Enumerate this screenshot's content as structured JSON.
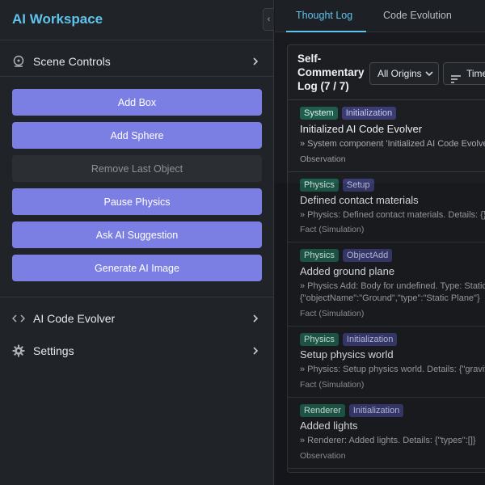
{
  "app": {
    "title": "AI Workspace",
    "collapse_glyph": "‹"
  },
  "sidebar": {
    "scene_controls": {
      "label": "Scene Controls",
      "icon": "scene-controls-icon"
    },
    "buttons": [
      {
        "label": "Add Box",
        "enabled": true
      },
      {
        "label": "Add Sphere",
        "enabled": true
      },
      {
        "label": "Remove Last Object",
        "enabled": false
      },
      {
        "label": "Pause Physics",
        "enabled": true
      },
      {
        "label": "Ask AI Suggestion",
        "enabled": true
      },
      {
        "label": "Generate AI Image",
        "enabled": true
      }
    ],
    "code_evolver": {
      "label": "AI Code Evolver",
      "icon": "code-icon"
    },
    "settings": {
      "label": "Settings",
      "icon": "gear-icon"
    }
  },
  "tabs": [
    {
      "label": "Thought Log",
      "active": true
    },
    {
      "label": "Code Evolution",
      "active": false
    }
  ],
  "log": {
    "title": "Self-Commentary Log (7 / 7)",
    "origin_filter": "All Origins",
    "sort_label": "Time"
  },
  "entries": [
    {
      "tags": [
        "System",
        "Initialization"
      ],
      "title": "Initialized AI Code Evolver",
      "detail": [
        "» System component 'Initialized AI Code Evolver'"
      ],
      "type": "Observation"
    },
    {
      "tags": [
        "Physics",
        "Setup"
      ],
      "title": "Defined contact materials",
      "detail": [
        "» Physics: Defined contact materials. Details: {}"
      ],
      "type": "Fact (Simulation)"
    },
    {
      "tags": [
        "Physics",
        "ObjectAdd"
      ],
      "title": "Added ground plane",
      "detail": [
        "» Physics Add: Body for undefined. Type: Static",
        "{\"objectName\":\"Ground\",\"type\":\"Static Plane\"}"
      ],
      "type": "Fact (Simulation)"
    },
    {
      "tags": [
        "Physics",
        "Initialization"
      ],
      "title": "Setup physics world",
      "detail": [
        "» Physics: Setup physics world. Details: {\"gravity\"}"
      ],
      "type": "Fact (Simulation)"
    },
    {
      "tags": [
        "Renderer",
        "Initialization"
      ],
      "title": "Added lights",
      "detail": [
        "» Renderer: Added lights. Details: {\"types\":[]}"
      ],
      "type": "Observation"
    }
  ],
  "colors": {
    "accent": "#5fc3ee",
    "button": "#7b7fe4",
    "tag_category": "#1f5e4e",
    "tag_subcategory": "#3b3d72"
  }
}
